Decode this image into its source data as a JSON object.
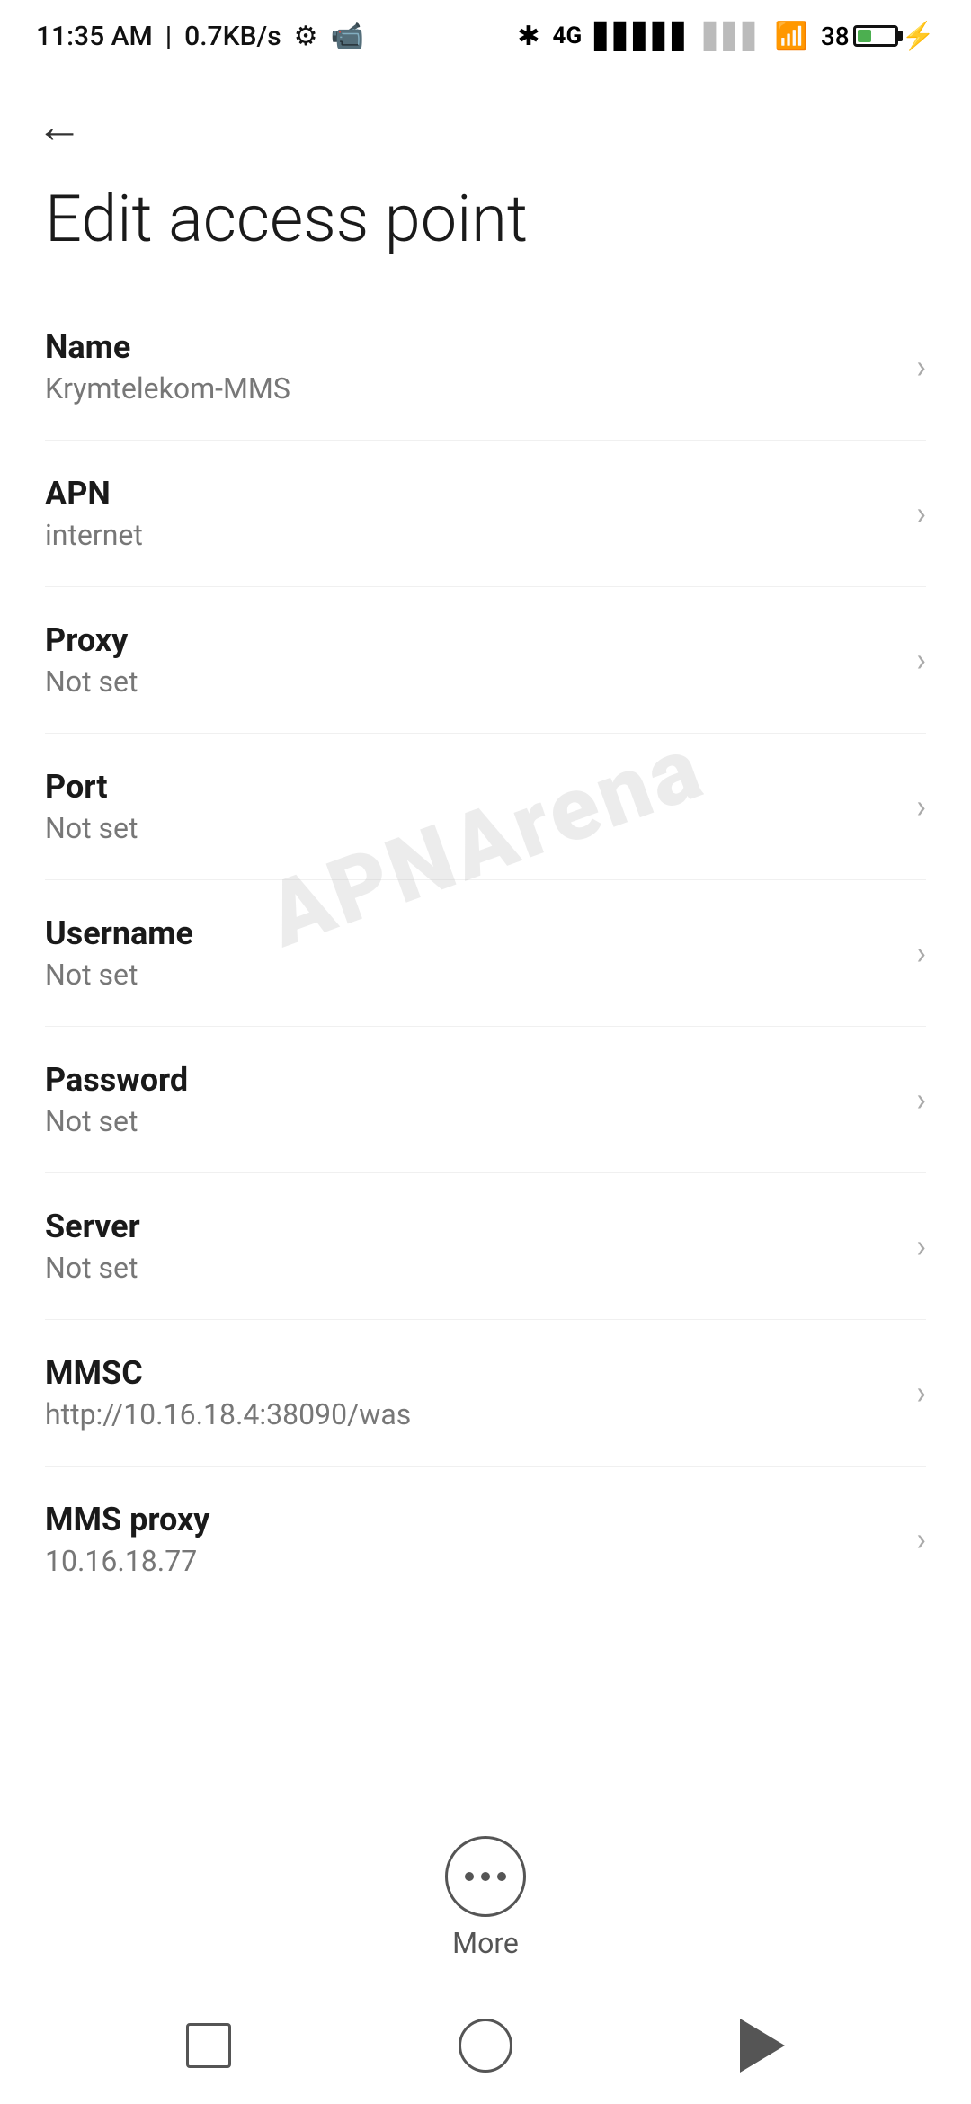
{
  "statusBar": {
    "time": "11:35 AM",
    "speed": "0.7KB/s"
  },
  "header": {
    "backLabel": "←",
    "title": "Edit access point"
  },
  "settings": {
    "items": [
      {
        "label": "Name",
        "value": "Krymtelekom-MMS"
      },
      {
        "label": "APN",
        "value": "internet"
      },
      {
        "label": "Proxy",
        "value": "Not set"
      },
      {
        "label": "Port",
        "value": "Not set"
      },
      {
        "label": "Username",
        "value": "Not set"
      },
      {
        "label": "Password",
        "value": "Not set"
      },
      {
        "label": "Server",
        "value": "Not set"
      },
      {
        "label": "MMSC",
        "value": "http://10.16.18.4:38090/was"
      },
      {
        "label": "MMS proxy",
        "value": "10.16.18.77"
      }
    ]
  },
  "more": {
    "label": "More"
  },
  "watermark": "APNArena"
}
